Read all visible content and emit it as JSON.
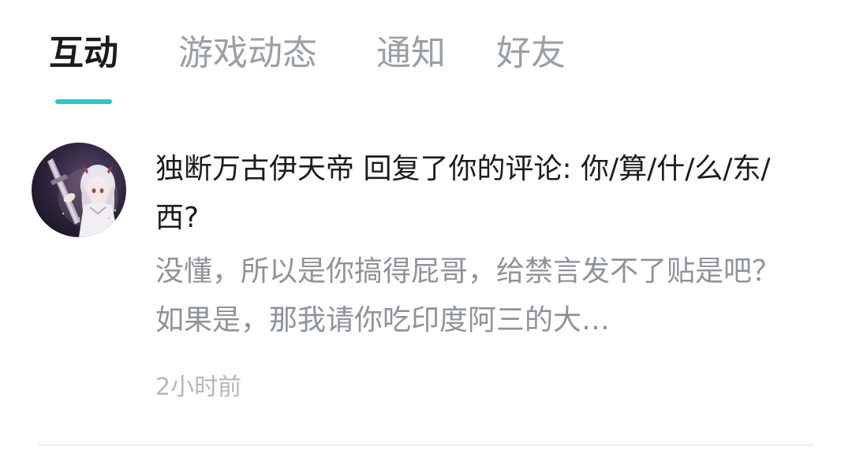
{
  "tabs": {
    "items": [
      {
        "label": "互动",
        "active": true
      },
      {
        "label": "游戏动态",
        "active": false
      },
      {
        "label": "通知",
        "active": false
      },
      {
        "label": "好友",
        "active": false
      }
    ],
    "indicator_color": "#2ec5c7"
  },
  "notification": {
    "title": "独断万古伊天帝 回复了你的评论: 你/算/什/么/东/西?",
    "preview": "没懂，所以是你搞得屁哥，给禁言发不了贴是吧？如果是，那我请你吃印度阿三的大…",
    "time": "2小时前",
    "avatar_icon": "anime-character-avatar"
  }
}
